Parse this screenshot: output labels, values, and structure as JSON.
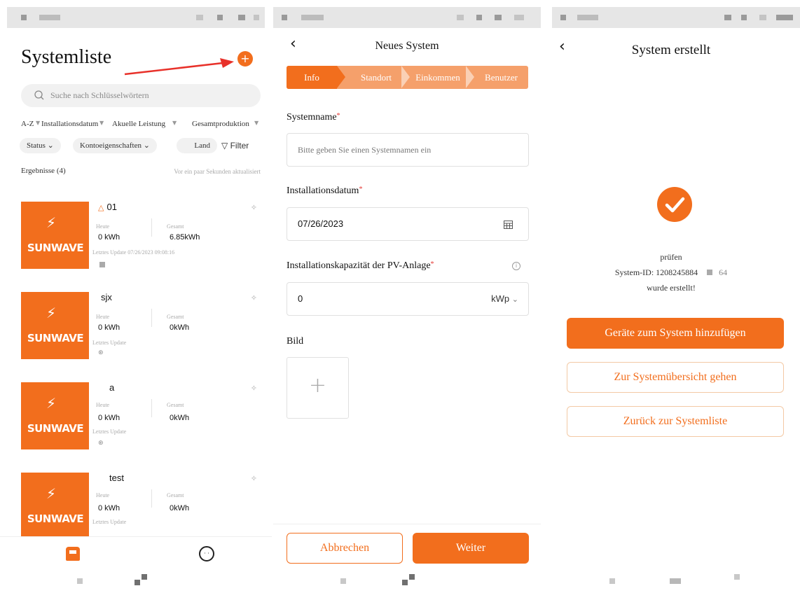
{
  "colors": {
    "accent": "#f26e1d",
    "accent_light": "#f5a06b",
    "required": "#e53935"
  },
  "list_screen": {
    "title": "Systemliste",
    "add_icon": "plus-circle-icon",
    "search": {
      "placeholder": "Suche nach Schlüsselwörtern"
    },
    "sort": {
      "az": "A-Z",
      "installation_date": "Installationsdatum",
      "current_power": "Akuelle Leistung",
      "total_production": "Gesamtproduktion"
    },
    "filters": {
      "status": "Status",
      "account_properties": "Kontoeigenschaften",
      "country": "Land",
      "filter": "Filter"
    },
    "results_label": "Ergebnisse (4)",
    "updated_label": "Vor ein paar Sekunden aktualisiert",
    "brand": "SUNWAVE",
    "today_label": "Heute",
    "total_label": "Gesamt",
    "last_update_label": "Letztes Update",
    "systems": [
      {
        "name": "01",
        "today": "0 kWh",
        "total": "6.85kWh",
        "last_update": "07/26/2023 09:08:16"
      },
      {
        "name": "sjx",
        "today": "0 kWh",
        "total": "0kWh",
        "last_update": ""
      },
      {
        "name": "a",
        "today": "0 kWh",
        "total": "0kWh",
        "last_update": ""
      },
      {
        "name": "test",
        "today": "0 kWh",
        "total": "0kWh",
        "last_update": ""
      }
    ]
  },
  "new_system_screen": {
    "title": "Neues System",
    "steps": [
      "Info",
      "Standort",
      "Einkommen",
      "Benutzer"
    ],
    "system_name": {
      "label": "Systemname",
      "placeholder": "Bitte geben Sie einen Systemnamen ein"
    },
    "installation_date": {
      "label": "Installationsdatum",
      "value": "07/26/2023"
    },
    "capacity": {
      "label": "Installationskapazität der PV-Anlage",
      "value": "0",
      "unit": "kWp"
    },
    "image_label": "Bild",
    "required_mark": "*",
    "cancel": "Abbrechen",
    "next": "Weiter"
  },
  "created_screen": {
    "title": "System erstellt",
    "check": "prüfen",
    "system_id": "System-ID: 1208245884",
    "system_id_tail": "64",
    "created": "wurde erstellt!",
    "add_devices": "Geräte zum System hinzufügen",
    "go_overview": "Zur Systemübersicht gehen",
    "back_list": "Zurück zur Systemliste"
  }
}
